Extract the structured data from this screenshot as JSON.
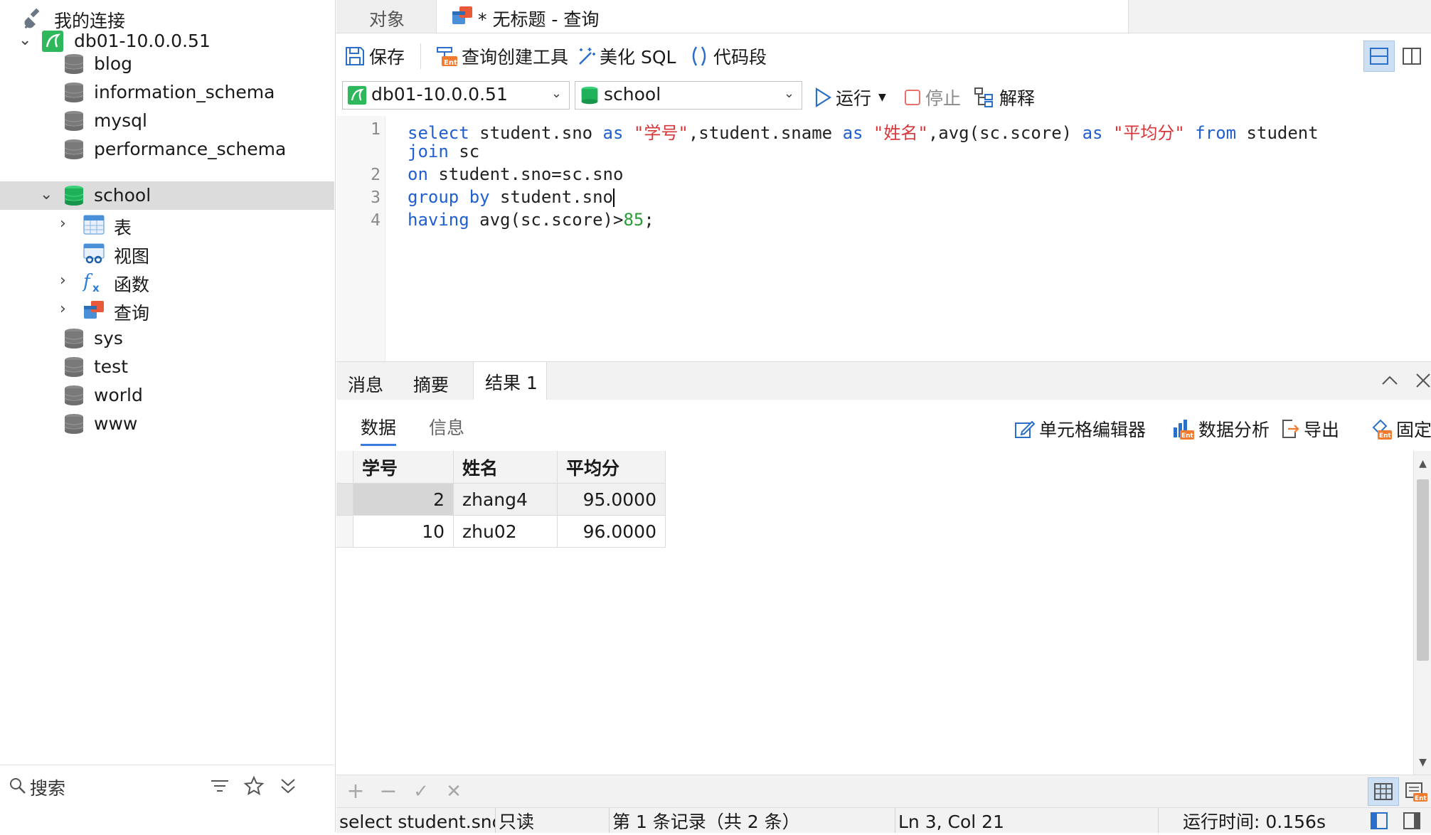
{
  "sidebar": {
    "header": "我的连接",
    "connection": "db01-10.0.0.51",
    "databases": [
      "blog",
      "information_schema",
      "mysql",
      "performance_schema",
      "school",
      "sys",
      "test",
      "world",
      "www"
    ],
    "school_children": [
      "表",
      "视图",
      "函数",
      "查询"
    ],
    "search_placeholder": "搜索"
  },
  "tabs": {
    "objects": "对象",
    "query": "* 无标题 - 查询"
  },
  "toolbar": {
    "save": "保存",
    "query_builder": "查询创建工具",
    "beautify": "美化 SQL",
    "snippet": "代码段",
    "run": "运行",
    "stop": "停止",
    "explain": "解释"
  },
  "selectors": {
    "connection": "db01-10.0.0.51",
    "database": "school"
  },
  "editor": {
    "line_numbers": [
      "1",
      "2",
      "3",
      "4"
    ]
  },
  "results": {
    "tabs": [
      "消息",
      "摘要",
      "结果 1"
    ],
    "subtabs": [
      "数据",
      "信息"
    ],
    "tools": {
      "cell_editor": "单元格编辑器",
      "data_analysis": "数据分析",
      "export": "导出",
      "pin": "固定"
    },
    "columns": [
      "学号",
      "姓名",
      "平均分"
    ],
    "rows": [
      [
        "2",
        "zhang4",
        "95.0000"
      ],
      [
        "10",
        "zhu02",
        "96.0000"
      ]
    ]
  },
  "status": {
    "query_snippet": "select student.sno a",
    "mode": "只读",
    "records": "第 1 条记录（共 2 条）",
    "cursor": "Ln 3, Col 21",
    "runtime": "运行时间: 0.156s"
  },
  "colors": {
    "keyword": "#1f5fd1",
    "string": "#d9363a",
    "number": "#2a9d3a",
    "selection": "#dcdcdc",
    "db_active": "#1fb15a"
  }
}
